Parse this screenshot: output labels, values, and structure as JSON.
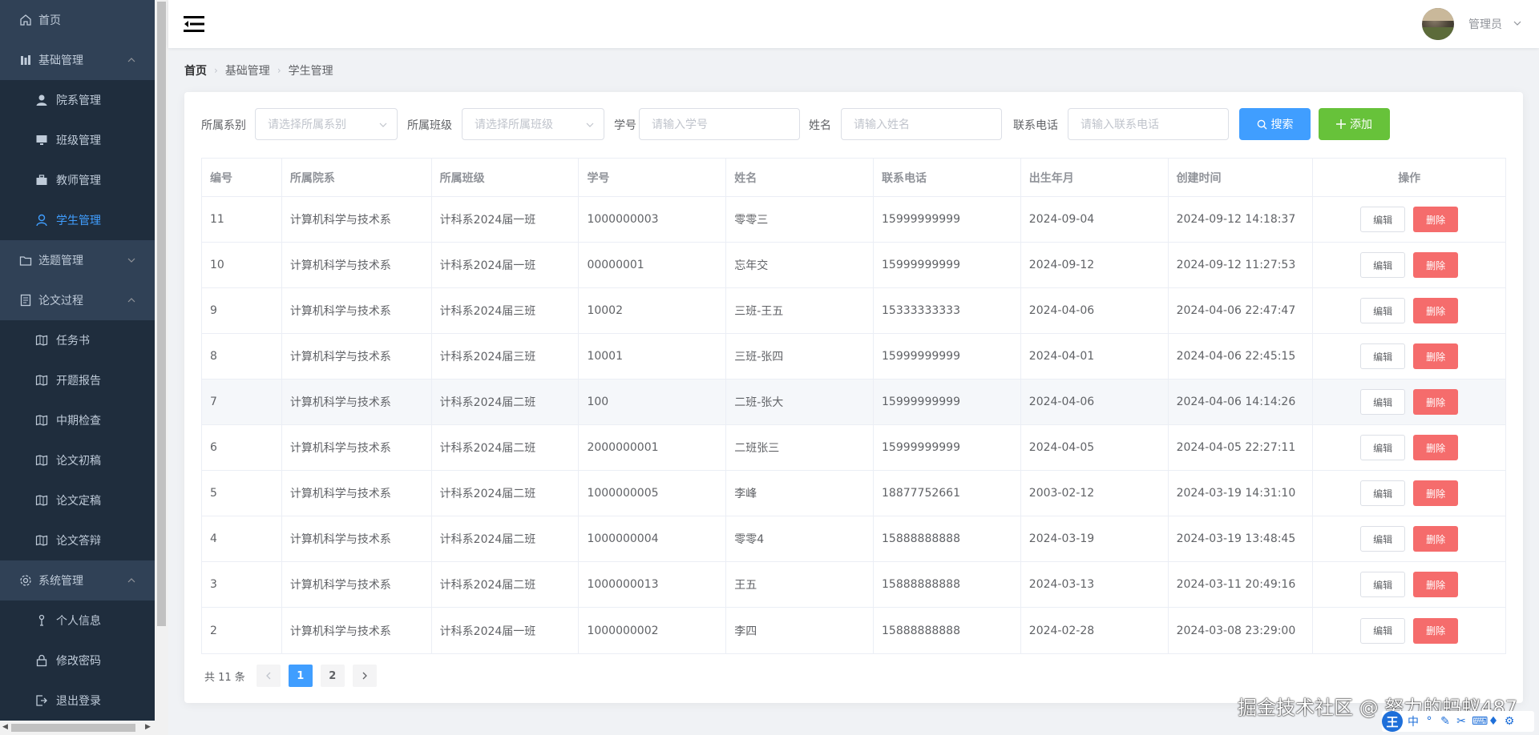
{
  "sidebar": {
    "items": [
      {
        "label": "首页",
        "icon": "home-icon"
      },
      {
        "label": "基础管理",
        "icon": "chart-icon"
      },
      {
        "label": "院系管理",
        "icon": "user-icon"
      },
      {
        "label": "班级管理",
        "icon": "monitor-icon"
      },
      {
        "label": "教师管理",
        "icon": "briefcase-icon"
      },
      {
        "label": "学生管理",
        "icon": "user-outline-icon"
      },
      {
        "label": "选题管理",
        "icon": "folder-icon"
      },
      {
        "label": "论文过程",
        "icon": "document-icon"
      },
      {
        "label": "任务书",
        "icon": "book-icon"
      },
      {
        "label": "开题报告",
        "icon": "book-icon"
      },
      {
        "label": "中期检查",
        "icon": "book-icon"
      },
      {
        "label": "论文初稿",
        "icon": "book-icon"
      },
      {
        "label": "论文定稿",
        "icon": "book-icon"
      },
      {
        "label": "论文答辩",
        "icon": "book-icon"
      },
      {
        "label": "系统管理",
        "icon": "gear-icon"
      },
      {
        "label": "个人信息",
        "icon": "person-icon"
      },
      {
        "label": "修改密码",
        "icon": "lock-icon"
      },
      {
        "label": "退出登录",
        "icon": "exit-icon"
      }
    ],
    "active_color": "#409eff",
    "bg_color": "#304156"
  },
  "header": {
    "username": "管理员"
  },
  "breadcrumb": [
    "首页",
    "基础管理",
    "学生管理"
  ],
  "filters": {
    "dept_label": "所属系别",
    "dept_placeholder": "请选择所属系别",
    "class_label": "所属班级",
    "class_placeholder": "请选择所属班级",
    "id_label": "学号",
    "id_placeholder": "请输入学号",
    "name_label": "姓名",
    "name_placeholder": "请输入姓名",
    "phone_label": "联系电话",
    "phone_placeholder": "请输入联系电话",
    "search_label": "搜索",
    "add_label": "添加"
  },
  "table": {
    "headers": [
      "编号",
      "所属院系",
      "所属班级",
      "学号",
      "姓名",
      "联系电话",
      "出生年月",
      "创建时间",
      "操作"
    ],
    "edit_label": "编辑",
    "delete_label": "删除",
    "rows": [
      [
        "11",
        "计算机科学与技术系",
        "计科系2024届一班",
        "1000000003",
        "零零三",
        "15999999999",
        "2024-09-04",
        "2024-09-12 14:18:37"
      ],
      [
        "10",
        "计算机科学与技术系",
        "计科系2024届一班",
        "00000001",
        "忘年交",
        "15999999999",
        "2024-09-12",
        "2024-09-12 11:27:53"
      ],
      [
        "9",
        "计算机科学与技术系",
        "计科系2024届三班",
        "10002",
        "三班-王五",
        "15333333333",
        "2024-04-06",
        "2024-04-06 22:47:47"
      ],
      [
        "8",
        "计算机科学与技术系",
        "计科系2024届三班",
        "10001",
        "三班-张四",
        "15999999999",
        "2024-04-01",
        "2024-04-06 22:45:15"
      ],
      [
        "7",
        "计算机科学与技术系",
        "计科系2024届二班",
        "100",
        "二班-张大",
        "15999999999",
        "2024-04-06",
        "2024-04-06 14:14:26"
      ],
      [
        "6",
        "计算机科学与技术系",
        "计科系2024届二班",
        "2000000001",
        "二班张三",
        "15999999999",
        "2024-04-05",
        "2024-04-05 22:27:11"
      ],
      [
        "5",
        "计算机科学与技术系",
        "计科系2024届二班",
        "1000000005",
        "李峰",
        "18877752661",
        "2003-02-12",
        "2024-03-19 14:31:10"
      ],
      [
        "4",
        "计算机科学与技术系",
        "计科系2024届二班",
        "1000000004",
        "零零4",
        "15888888888",
        "2024-03-19",
        "2024-03-19 13:48:45"
      ],
      [
        "3",
        "计算机科学与技术系",
        "计科系2024届二班",
        "1000000013",
        "王五",
        "15888888888",
        "2024-03-13",
        "2024-03-11 20:49:16"
      ],
      [
        "2",
        "计算机科学与技术系",
        "计科系2024届一班",
        "1000000002",
        "李四",
        "15888888888",
        "2024-02-28",
        "2024-03-08 23:29:00"
      ]
    ]
  },
  "pagination": {
    "total_text": "共 11 条",
    "pages": [
      "1",
      "2"
    ],
    "current": "1"
  },
  "watermark": "掘金技术社区 @ 努力的蚂蚁487",
  "ime": {
    "logo": "王",
    "mode": "中"
  }
}
